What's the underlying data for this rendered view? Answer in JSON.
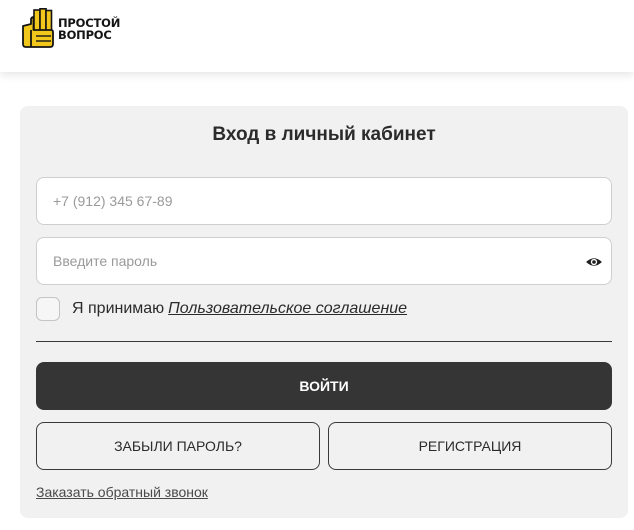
{
  "header": {
    "logo": {
      "line1": "ПРОСТОЙ",
      "line2": "ВОПРОС",
      "icon": "thumbs-up-book-icon",
      "accent": "#f2c71b"
    }
  },
  "login": {
    "title": "Вход в личный кабинет",
    "phone": {
      "placeholder": "+7 (912) 345 67-89",
      "value": ""
    },
    "password": {
      "placeholder": "Введите пароль",
      "value": "",
      "toggle_icon": "eye-icon"
    },
    "agreement": {
      "text": "Я принимаю",
      "link": "Пользовательское соглашение",
      "checked": false
    },
    "login_button": "ВОЙТИ",
    "forgot_button": "ЗАБЫЛИ ПАРОЛЬ?",
    "register_button": "РЕГИСТРАЦИЯ",
    "callback_link": "Заказать обратный звонок"
  },
  "colors": {
    "card_bg": "#f1f1f1",
    "primary_button": "#353535",
    "logo_yellow": "#f2c71b"
  }
}
